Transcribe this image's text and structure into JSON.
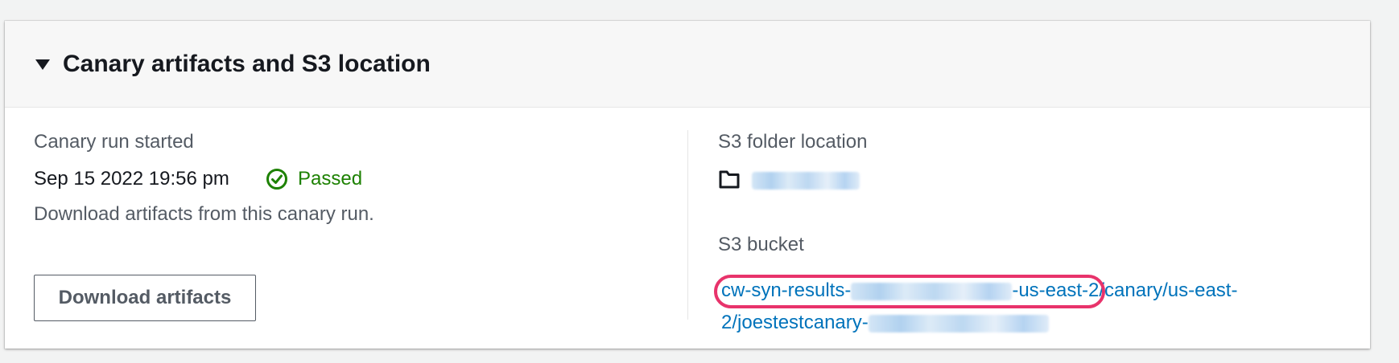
{
  "panel": {
    "title": "Canary artifacts and S3 location",
    "caret_icon": "caret-down-icon"
  },
  "run": {
    "label": "Canary run started",
    "started_at": "Sep 15 2022 19:56 pm",
    "status": "Passed",
    "status_icon": "check-circle-icon",
    "status_color": "#1d8102"
  },
  "download": {
    "description": "Download artifacts from this canary run.",
    "button_label": "Download artifacts"
  },
  "s3_folder": {
    "label": "S3 folder location",
    "folder_icon": "folder-icon"
  },
  "s3_bucket": {
    "label": "S3 bucket",
    "link_part1_prefix": "cw-syn-results-",
    "link_part1_suffix": "-us-east-2",
    "link_part2": "/canary/us-east-",
    "link_part3_prefix": "2/joestestcanary-",
    "link_color": "#0073bb",
    "highlight_color": "#e8336b"
  }
}
